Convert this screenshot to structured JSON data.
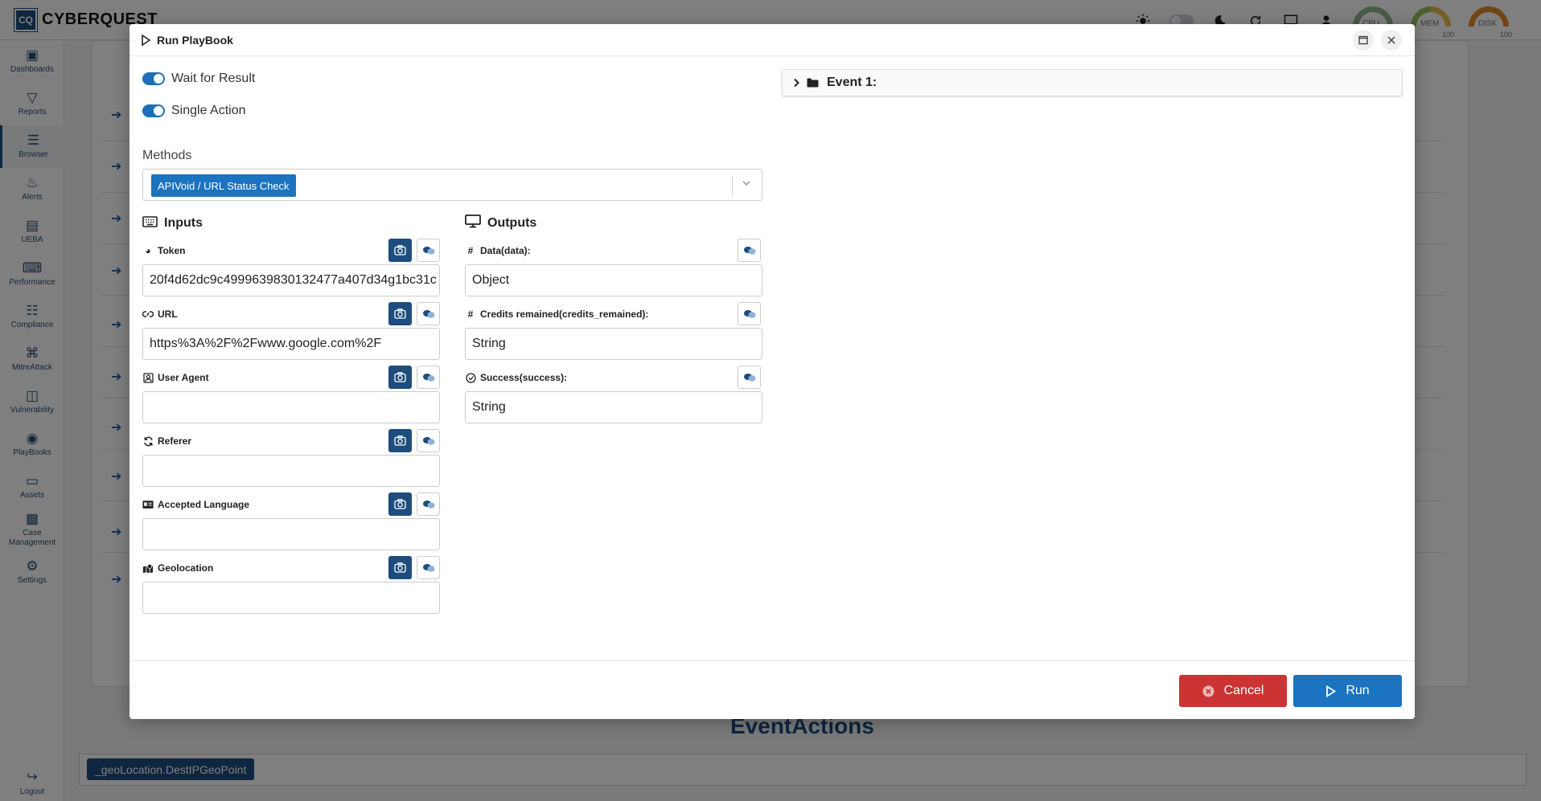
{
  "app": {
    "logo_mark": "CQ",
    "logo_text": "CYBERQUEST",
    "gauges": [
      {
        "label": "CPU",
        "max": ""
      },
      {
        "label": "MEM",
        "max": "100"
      },
      {
        "label": "DISK",
        "min": "0",
        "max": "100"
      }
    ]
  },
  "sidebar": {
    "items": [
      {
        "label": "Dashboards",
        "icon": "dashboard-icon"
      },
      {
        "label": "Reports",
        "icon": "filter-icon"
      },
      {
        "label": "Browser",
        "icon": "list-icon"
      },
      {
        "label": "Alerts",
        "icon": "bell-icon"
      },
      {
        "label": "UEBA",
        "icon": "chart-icon"
      },
      {
        "label": "Performance",
        "icon": "keyboard-icon"
      },
      {
        "label": "Compliance",
        "icon": "compliance-icon"
      },
      {
        "label": "MitreAttack",
        "icon": "command-icon"
      },
      {
        "label": "Vulnerability",
        "icon": "stack-icon"
      },
      {
        "label": "PlayBooks",
        "icon": "playbook-icon"
      },
      {
        "label": "Assets",
        "icon": "laptop-icon"
      },
      {
        "label": "Case Management",
        "icon": "briefcase-icon"
      },
      {
        "label": "Settings",
        "icon": "gear-icon"
      }
    ],
    "logout_label": "Logout"
  },
  "background": {
    "event_actions_title": "EventActions",
    "tag": "_geoLocation.DestIPGeoPoint"
  },
  "modal": {
    "title": "Run PlayBook",
    "wait_for_result": {
      "label": "Wait for Result",
      "on": true
    },
    "single_action": {
      "label": "Single Action",
      "on": true
    },
    "methods_label": "Methods",
    "selected_method": "APIVoid / URL Status Check",
    "inputs_title": "Inputs",
    "outputs_title": "Outputs",
    "inputs": [
      {
        "label": "Token",
        "value": "20f4d62dc9c4999639830132477a407d34g1bc31c",
        "icon": "palette-icon"
      },
      {
        "label": "URL",
        "value": "https%3A%2F%2Fwww.google.com%2F",
        "icon": "link-icon"
      },
      {
        "label": "User Agent",
        "value": "",
        "icon": "user-badge-icon"
      },
      {
        "label": "Referer",
        "value": "",
        "icon": "refresh-icon"
      },
      {
        "label": "Accepted Language",
        "value": "",
        "icon": "id-card-icon"
      },
      {
        "label": "Geolocation",
        "value": "",
        "icon": "map-location-icon"
      }
    ],
    "outputs": [
      {
        "label": "Data(data):",
        "value": "Object",
        "icon": "hash-icon"
      },
      {
        "label": "Credits remained(credits_remained):",
        "value": "String",
        "icon": "hash-icon"
      },
      {
        "label": "Success(success):",
        "value": "String",
        "icon": "check-circle-icon"
      }
    ],
    "event_label": "Event 1:",
    "cancel_label": "Cancel",
    "run_label": "Run"
  }
}
